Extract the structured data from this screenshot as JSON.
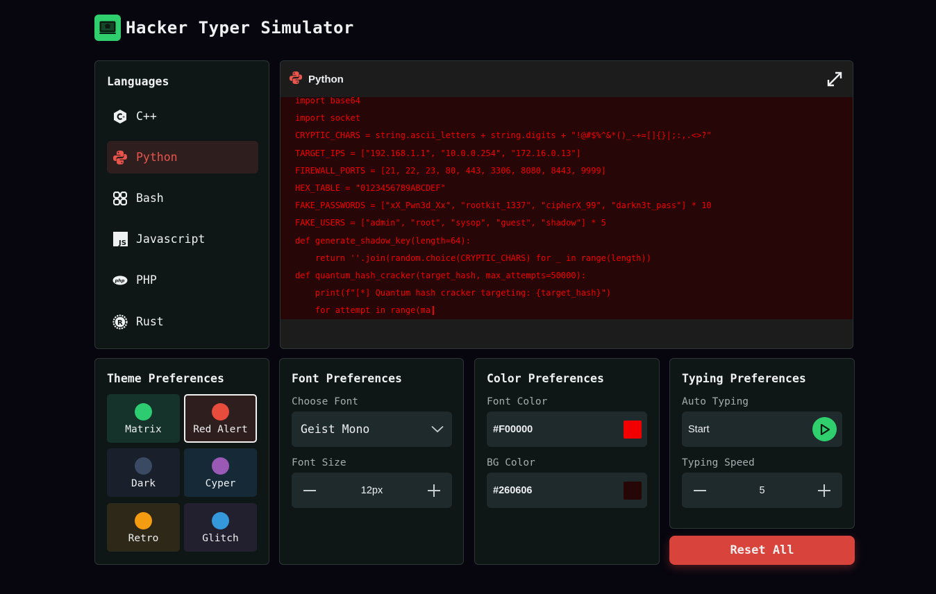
{
  "app": {
    "title": "Hacker Typer Simulator"
  },
  "languages": {
    "title": "Languages",
    "items": [
      {
        "label": "C++",
        "icon": "cpp-icon"
      },
      {
        "label": "Python",
        "icon": "python-icon",
        "active": true
      },
      {
        "label": "Bash",
        "icon": "bash-icon"
      },
      {
        "label": "Javascript",
        "icon": "javascript-icon"
      },
      {
        "label": "PHP",
        "icon": "php-icon"
      },
      {
        "label": "Rust",
        "icon": "rust-icon"
      }
    ]
  },
  "editor": {
    "language": "Python",
    "lines": [
      "import base64",
      "import socket",
      "CRYPTIC_CHARS = string.ascii_letters + string.digits + \"!@#$%^&*()_-+=[]{}|;:,.<>?\"",
      "TARGET_IPS = [\"192.168.1.1\", \"10.0.0.254\", \"172.16.0.13\"]",
      "FIREWALL_PORTS = [21, 22, 23, 80, 443, 3306, 8080, 8443, 9999]",
      "HEX_TABLE = \"0123456789ABCDEF\"",
      "FAKE_PASSWORDS = [\"xX_Pwn3d_Xx\", \"rootkit_1337\", \"cipherX_99\", \"darkn3t_pass\"] * 10",
      "FAKE_USERS = [\"admin\", \"root\", \"sysop\", \"guest\", \"shadow\"] * 5",
      "def generate_shadow_key(length=64):",
      "    return ''.join(random.choice(CRYPTIC_CHARS) for _ in range(length))",
      "def quantum_hash_cracker(target_hash, max_attempts=50000):",
      "    print(f\"[*] Quantum hash cracker targeting: {target_hash}\")",
      "    for attempt in range(ma"
    ]
  },
  "theme": {
    "title": "Theme Preferences",
    "options": [
      {
        "label": "Matrix",
        "color": "#2ecc71",
        "bg": "#15332a"
      },
      {
        "label": "Red Alert",
        "color": "#e74c3c",
        "bg": "#2f1e1e",
        "selected": true
      },
      {
        "label": "Dark",
        "color": "#3a4a63",
        "bg": "#19202b"
      },
      {
        "label": "Cyper",
        "color": "#9b59b6",
        "bg": "#152a36"
      },
      {
        "label": "Retro",
        "color": "#f39c12",
        "bg": "#2e2818"
      },
      {
        "label": "Glitch",
        "color": "#3498db",
        "bg": "#221f2e"
      }
    ]
  },
  "font": {
    "title": "Font Preferences",
    "choose_label": "Choose Font",
    "selected_font": "Geist Mono",
    "size_label": "Font Size",
    "size_value": "12px"
  },
  "colors": {
    "title": "Color Preferences",
    "font_color_label": "Font Color",
    "font_color": "#F00000",
    "bg_color_label": "BG Color",
    "bg_color": "#260606"
  },
  "typing": {
    "title": "Typing Preferences",
    "auto_label": "Auto Typing",
    "start_label": "Start",
    "speed_label": "Typing Speed",
    "speed_value": "5"
  },
  "reset_label": "Reset All"
}
